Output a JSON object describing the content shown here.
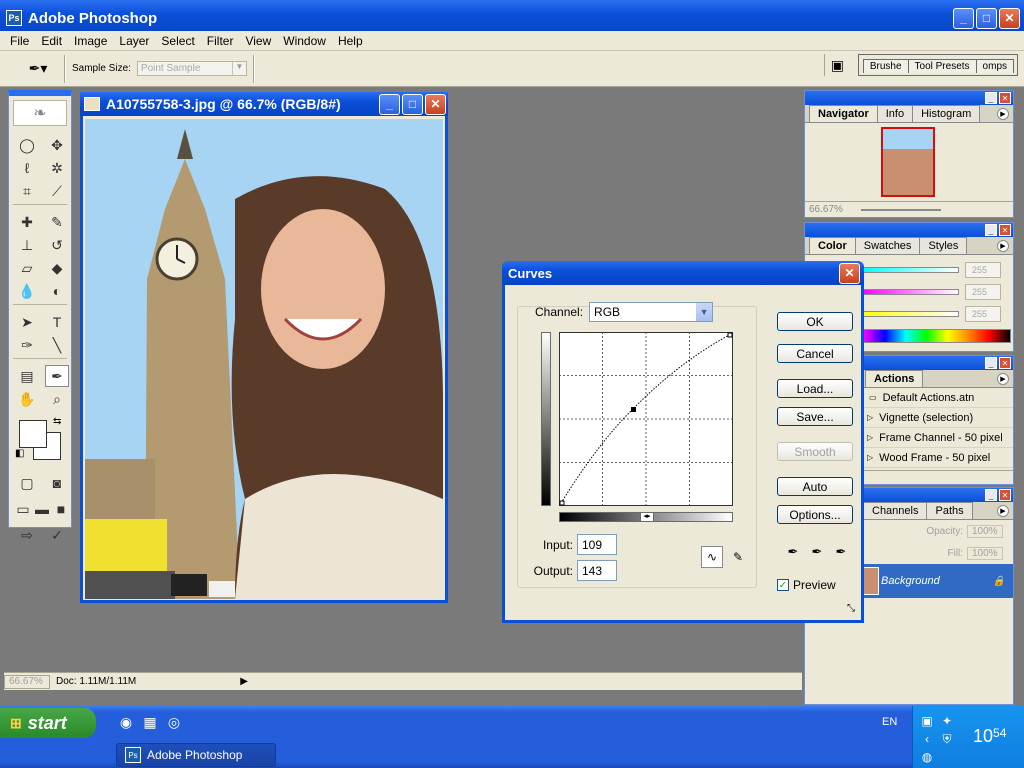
{
  "app": {
    "title": "Adobe Photoshop"
  },
  "menu": [
    "File",
    "Edit",
    "Image",
    "Layer",
    "Select",
    "Filter",
    "View",
    "Window",
    "Help"
  ],
  "options_bar": {
    "sample_size_label": "Sample Size:",
    "sample_size_value": "Point Sample",
    "palette_well_tabs": [
      "Brushe",
      "Tool Presets",
      "omps"
    ]
  },
  "document": {
    "title": "A10755758-3.jpg @ 66.7% (RGB/8#)"
  },
  "status": {
    "zoom": "66.67%",
    "doc": "Doc: 1.11M/1.11M"
  },
  "navigator": {
    "tabs": [
      "Navigator",
      "Info",
      "Histogram"
    ],
    "zoom": "66.67%"
  },
  "color_palette": {
    "tabs": [
      "Color",
      "Swatches",
      "Styles"
    ],
    "values": [
      "255",
      "255",
      "255"
    ]
  },
  "actions": {
    "tab": "Actions",
    "items": [
      "Default Actions.atn",
      "Vignette (selection)",
      "Frame Channel - 50 pixel",
      "Wood Frame - 50 pixel"
    ]
  },
  "layers": {
    "tabs": [
      "Channels",
      "Paths"
    ],
    "opacity_label": "Opacity:",
    "opacity": "100%",
    "fill_label": "Fill:",
    "fill": "100%",
    "layer_name": "Background"
  },
  "curves": {
    "title": "Curves",
    "channel_label": "Channel:",
    "channel": "RGB",
    "input_label": "Input:",
    "input": "109",
    "output_label": "Output:",
    "output": "143",
    "buttons": {
      "ok": "OK",
      "cancel": "Cancel",
      "load": "Load...",
      "save": "Save...",
      "smooth": "Smooth",
      "auto": "Auto",
      "options": "Options..."
    },
    "preview_label": "Preview",
    "preview_checked": true
  },
  "taskbar": {
    "start": "start",
    "task": "Adobe Photoshop",
    "lang": "EN",
    "time_hour": "10",
    "time_min": "54"
  },
  "colors": {
    "xp_blue": "#0a4fd8",
    "selected_layer": "#316ac5",
    "canvas_sky": "#a8d4f4"
  }
}
